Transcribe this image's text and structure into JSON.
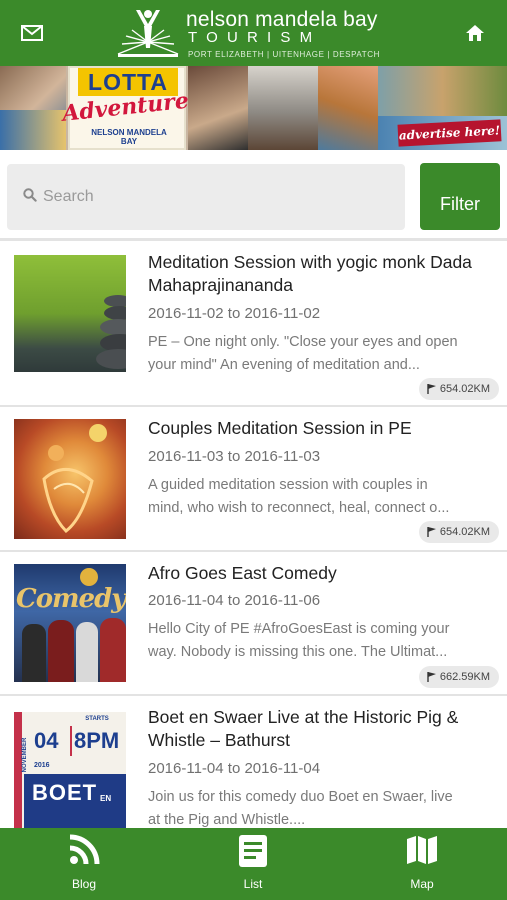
{
  "header": {
    "brand_name": "nelson mandela bay",
    "brand_sub": "TOURISM",
    "brand_places": "PORT ELIZABETH | UITENHAGE | DESPATCH",
    "left_icon": "mail-icon",
    "right_icon": "home-icon"
  },
  "banner": {
    "headline_1": "LOTTA",
    "headline_2": "Adventure!",
    "tagline": "NELSON MANDELA BAY",
    "cta": "advertise here!"
  },
  "search": {
    "placeholder": "Search",
    "value": "",
    "filter_label": "Filter"
  },
  "events": [
    {
      "title": "Meditation Session with yogic monk Dada Mahaprajinananda",
      "dates": "2016-11-02 to 2016-11-02",
      "desc_line1": "PE – One night only. \"Close your eyes and open",
      "desc_line2": "your mind\" An evening of meditation and...",
      "distance": "654.02KM"
    },
    {
      "title": "Couples Meditation Session in PE",
      "dates": "2016-11-03 to 2016-11-03",
      "desc_line1": "A guided meditation session with couples in",
      "desc_line2": "mind, who wish to reconnect, heal, connect o...",
      "distance": "654.02KM"
    },
    {
      "title": "Afro Goes East Comedy",
      "dates": "2016-11-04 to 2016-11-06",
      "desc_line1": "Hello City of PE #AfroGoesEast is coming your",
      "desc_line2": "way. Nobody is missing this one. The Ultimat...",
      "distance": "662.59KM",
      "thumb_text": "Comedy"
    },
    {
      "title": "Boet en Swaer Live at the Historic Pig & Whistle – Bathurst",
      "dates": "2016-11-04 to 2016-11-04",
      "desc_line1": "Join us for this comedy duo Boet en Swaer, live",
      "desc_line2": "at the Pig and Whistle....",
      "thumb_day": "04",
      "thumb_time": "8PM",
      "thumb_starts": "STARTS",
      "thumb_month": "NOVEMBER",
      "thumb_year": "2016",
      "thumb_name": "BOET",
      "thumb_en": "EN"
    }
  ],
  "nav": [
    {
      "label": "Blog",
      "icon": "rss-icon"
    },
    {
      "label": "List",
      "icon": "list-icon"
    },
    {
      "label": "Map",
      "icon": "map-icon"
    }
  ],
  "colors": {
    "primary": "#3b8a2a",
    "search_bg": "#ececec",
    "badge_bg": "#e9e9e9"
  }
}
